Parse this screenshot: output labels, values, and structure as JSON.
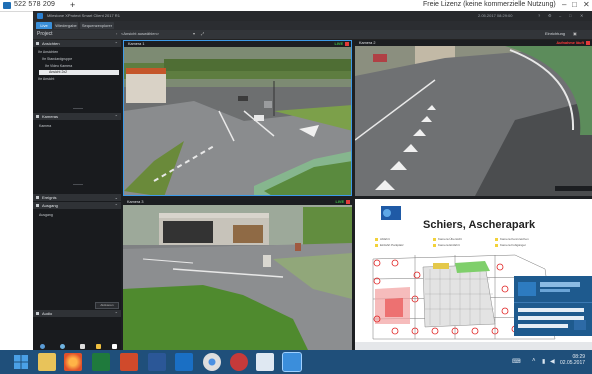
{
  "remote_bar": {
    "session_id": "522 578 209",
    "add_symbol": "+",
    "license_text": "Freie Lizenz (keine kommerzielle Nutzung)",
    "window_controls": [
      "–",
      "□",
      "✕"
    ]
  },
  "app": {
    "title": "Milestone XProtect Smart Client 2017 R1",
    "titlebar_right": "2.05.2017 08:29:00",
    "tabs": [
      "Live",
      "Wiedergabe",
      "Sequenzexplorer"
    ],
    "active_tab": "Live",
    "subbar": {
      "project": "Project",
      "view_selector": "<Ansicht auswählen>",
      "setup": "Einrichtung"
    }
  },
  "left_panel": {
    "sections": [
      {
        "title": "Ansichten",
        "items": [
          "Ihr Ansichten",
          "Ihr Standardgruppe",
          "Ihr Video Kamera",
          "Ansicht 2x2",
          "Ihr Ansicht"
        ],
        "selected": "Ansicht 2x2"
      },
      {
        "title": "Kameras",
        "items": [
          "Kamera"
        ]
      },
      {
        "title": "Ereignis",
        "items": []
      },
      {
        "title": "Ausgang",
        "items": [
          "Ausgang"
        ]
      },
      {
        "title": "Audio",
        "items": []
      }
    ],
    "small_button": "Aktivieren"
  },
  "cameras": [
    {
      "name": "Kamera 1",
      "status": "LIVE"
    },
    {
      "name": "Kamera 2",
      "status": "Aufnahme läuft"
    },
    {
      "name": "Kamera 3",
      "status": "LIVE"
    }
  ],
  "map": {
    "title": "Schiers, Ascherapark",
    "logo": "DALLMEIER",
    "legend": [
      {
        "label": "Abfahrt",
        "color": "#f2d23a"
      },
      {
        "label": "Einfahrt Parkplatz",
        "color": "#f2d23a"
      },
      {
        "label": "Kamera Übersicht",
        "color": "#f2d23a"
      },
      {
        "label": "Kamera Einfahrt",
        "color": "#f2d23a"
      },
      {
        "label": "Kamera Kennzeichen",
        "color": "#f2d23a"
      },
      {
        "label": "Kamera Fußgänger",
        "color": "#f2d23a"
      }
    ]
  },
  "taskbar": {
    "time": "08:29",
    "date": "02.05.2017",
    "apps": [
      "start",
      "file-explorer",
      "firefox",
      "excel",
      "powerpoint",
      "word",
      "outlook",
      "chrome",
      "app-red",
      "notepad",
      "teamviewer"
    ]
  }
}
